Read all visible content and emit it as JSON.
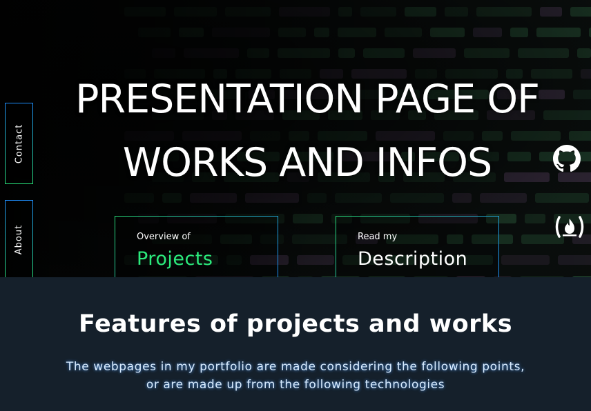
{
  "hero": {
    "title_line1": "PRESENTATION PAGE OF",
    "title_line2": "WORKS AND INFOS"
  },
  "side_nav": {
    "contact_label": "Contact",
    "about_label": "About"
  },
  "cards": {
    "projects": {
      "small": "Overview of",
      "big": "Projects"
    },
    "description": {
      "small": "Read my",
      "big": "Description"
    }
  },
  "social": {
    "github_icon": "github-icon",
    "freecodecamp_icon": "freecodecamp-icon"
  },
  "features": {
    "heading": "Features of projects and works",
    "line1": "The webpages in my portfolio are made considering the following points,",
    "line2": "or are made up from the following technologies"
  },
  "colors": {
    "accent_green": "#2bea7c",
    "accent_blue": "#1e8fff",
    "section_bg": "#15202b"
  }
}
